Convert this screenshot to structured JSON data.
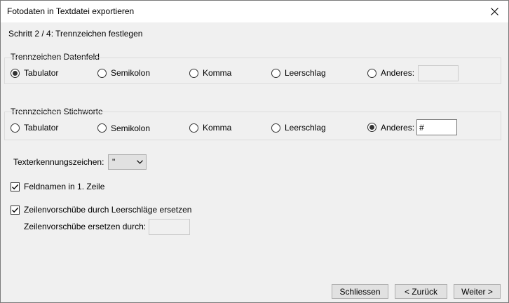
{
  "window": {
    "title": "Fotodaten in Textdatei exportieren"
  },
  "step_label": "Schritt 2 / 4: Trennzeichen festlegen",
  "field_separator": {
    "legend": "Trennzeichen Datenfeld",
    "options": [
      "Tabulator",
      "Semikolon",
      "Komma",
      "Leerschlag",
      "Anderes:"
    ],
    "selected": "Tabulator",
    "other_value": ""
  },
  "keyword_separator": {
    "legend": "Trennzeichen Stichworte",
    "options": [
      "Tabulator",
      "Semikolon",
      "Komma",
      "Leerschlag",
      "Anderes:"
    ],
    "selected": "Anderes:",
    "other_value": "#"
  },
  "text_qualifier": {
    "label": "Texterkennungszeichen:",
    "value": "\""
  },
  "field_names_first_row": {
    "label": "Feldnamen in 1. Zeile",
    "checked": true
  },
  "replace_line_breaks": {
    "label": "Zeilenvorschübe durch Leerschläge ersetzen",
    "checked": true,
    "replace_with_label": "Zeilenvorschübe ersetzen durch:",
    "replace_with_value": ""
  },
  "buttons": {
    "close": "Schliessen",
    "back": "< Zurück",
    "next": "Weiter >"
  }
}
